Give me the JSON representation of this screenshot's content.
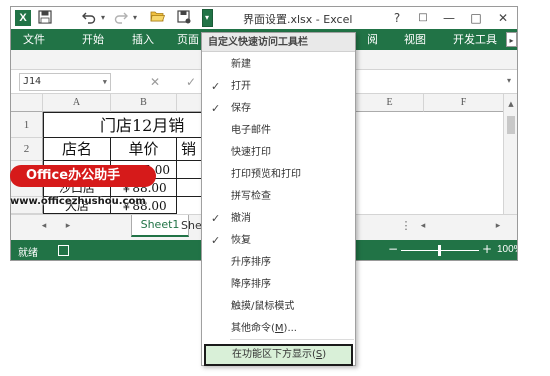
{
  "titlebar": {
    "logo_text": "X",
    "title": "界面设置.xlsx - Excel",
    "help": "?",
    "restore_ribbon": "□",
    "minimize": "—",
    "maximize": "□",
    "close": "✕"
  },
  "qat": {
    "save_icon": "save-icon",
    "undo_icon": "undo-icon",
    "redo_icon": "redo-icon",
    "open_icon": "folder-open-icon",
    "save_as_icon": "save-as-icon"
  },
  "ribbon": {
    "tabs": [
      "文件",
      "开始",
      "插入",
      "页面",
      "阅",
      "视图",
      "开发工具"
    ],
    "scroll": "▸"
  },
  "formula_bar": {
    "name_box": "J14",
    "cancel": "✕",
    "enter": "✓"
  },
  "grid": {
    "columns": [
      "A",
      "B",
      "E",
      "F"
    ],
    "rows": [
      "1",
      "2"
    ],
    "title_cell": "门店12月销",
    "headers": [
      "店名",
      "单价",
      "销"
    ],
    "row3": [
      "",
      "5.00"
    ],
    "row4": [
      "沙口店",
      "￥88.00"
    ],
    "row5": [
      "大店",
      "￥88.00"
    ]
  },
  "watermark": {
    "badge": "Office办公助手",
    "url": "www.officezhushou.com"
  },
  "sheets": {
    "tabs": [
      "Sheet1",
      "She"
    ],
    "prev": "◂",
    "next": "▸"
  },
  "status": {
    "ready": "就绪",
    "zoom_minus": "−",
    "zoom_plus": "+",
    "zoom": "100%"
  },
  "menu": {
    "header": "自定义快速访问工具栏",
    "items": [
      {
        "label": "新建",
        "checked": false
      },
      {
        "label": "打开",
        "checked": true
      },
      {
        "label": "保存",
        "checked": true
      },
      {
        "label": "电子邮件",
        "checked": false
      },
      {
        "label": "快速打印",
        "checked": false
      },
      {
        "label": "打印预览和打印",
        "checked": false
      },
      {
        "label": "拼写检查",
        "checked": false
      },
      {
        "label": "撤消",
        "checked": true
      },
      {
        "label": "恢复",
        "checked": true
      },
      {
        "label": "升序排序",
        "checked": false
      },
      {
        "label": "降序排序",
        "checked": false
      },
      {
        "label": "触摸/鼠标模式",
        "checked": false
      }
    ],
    "more_prefix": "其他命令(",
    "more_key": "M",
    "more_suffix": ")...",
    "below_prefix": "在功能区下方显示(",
    "below_key": "S",
    "below_suffix": ")",
    "check_mark": "✓"
  },
  "colors": {
    "accent": "#217346",
    "badge": "#d61a1a",
    "highlight": "#d9f0d8"
  }
}
